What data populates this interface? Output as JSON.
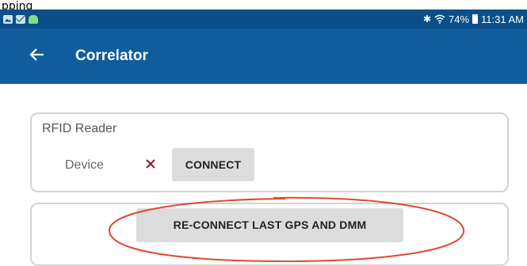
{
  "caption": "pping",
  "status_bar": {
    "notification_icons": [
      "gallery-icon",
      "mail-icon",
      "android-icon"
    ],
    "bluetooth_icon": "bluetooth-icon",
    "wifi_icon": "wifi-icon",
    "battery_percent": "74%",
    "battery_icon": "battery-icon",
    "time": "11:31 AM"
  },
  "app_bar": {
    "back_icon": "arrow-back-icon",
    "title": "Correlator",
    "color": "#0f5d9c"
  },
  "rfid_card": {
    "title": "RFID Reader",
    "device_label": "Device",
    "status_icon": "close-icon",
    "status_color": "#8b1a2b",
    "connect_label": "CONNECT"
  },
  "reconnect_card": {
    "button_label": "RE-CONNECT LAST GPS AND DMM",
    "annotation_color": "#e0482e"
  }
}
